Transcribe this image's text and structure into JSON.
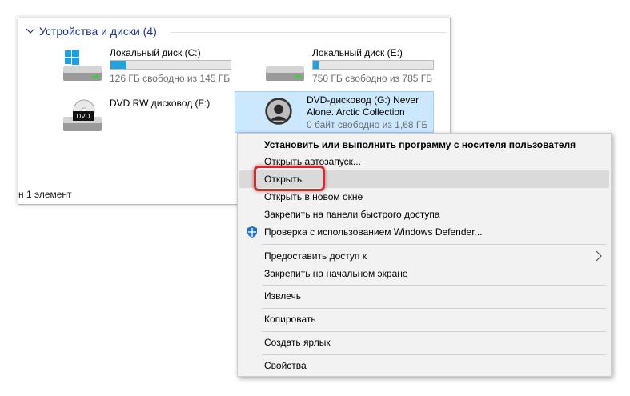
{
  "explorer": {
    "group_title": "Устройства и диски (4)",
    "status": "н 1 элемент",
    "drives": [
      {
        "name": "Локальный диск (C:)",
        "free_text": "126 ГБ свободно из 145 ГБ",
        "used_fraction": 0.13
      },
      {
        "name": "Локальный диск (E:)",
        "free_text": "750 ГБ свободно из 785 ГБ",
        "used_fraction": 0.05
      },
      {
        "name": "DVD RW дисковод (F:)"
      },
      {
        "name_line1": "DVD-дисковод (G:) Never",
        "name_line2": "Alone. Arctic Collection",
        "free_text": "0 байт свободно из 1,68 ГБ"
      }
    ],
    "dvd_label": "DVD"
  },
  "context_menu": {
    "items": [
      {
        "label": "Установить или выполнить программу с носителя пользователя"
      },
      {
        "label": "Открыть автозапуск..."
      },
      {
        "label": "Открыть"
      },
      {
        "label": "Открыть в новом окне"
      },
      {
        "label": "Закрепить на панели быстрого доступа"
      },
      {
        "label": "Проверка с использованием Windows Defender...",
        "icon": "windows-defender-icon"
      },
      {
        "label": "Предоставить доступ к",
        "icon": "chevron-right-icon"
      },
      {
        "label": "Закрепить на начальном экране"
      },
      {
        "label": "Извлечь"
      },
      {
        "label": "Копировать"
      },
      {
        "label": "Создать ярлык"
      },
      {
        "label": "Свойства"
      }
    ]
  },
  "colors": {
    "accent": "#26a0da",
    "selection": "#cce8ff",
    "highlight_ring": "#d9292e"
  }
}
